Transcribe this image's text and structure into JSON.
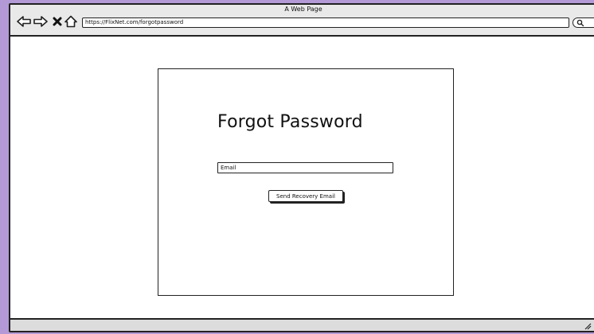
{
  "browser": {
    "title": "A Web Page",
    "url": "https://FlixNet.com/forgotpassword",
    "icons": [
      "back-arrow-icon",
      "forward-arrow-icon",
      "close-icon",
      "home-icon",
      "search-icon",
      "resize-grip-icon"
    ]
  },
  "page": {
    "heading": "Forgot Password",
    "email_placeholder": "Email",
    "send_button_label": "Send Recovery Email"
  },
  "colors": {
    "background_frame": "#b39ad6",
    "chrome": "#e9e9e9",
    "statusbar": "#dcdcdc",
    "ink": "#222222"
  }
}
